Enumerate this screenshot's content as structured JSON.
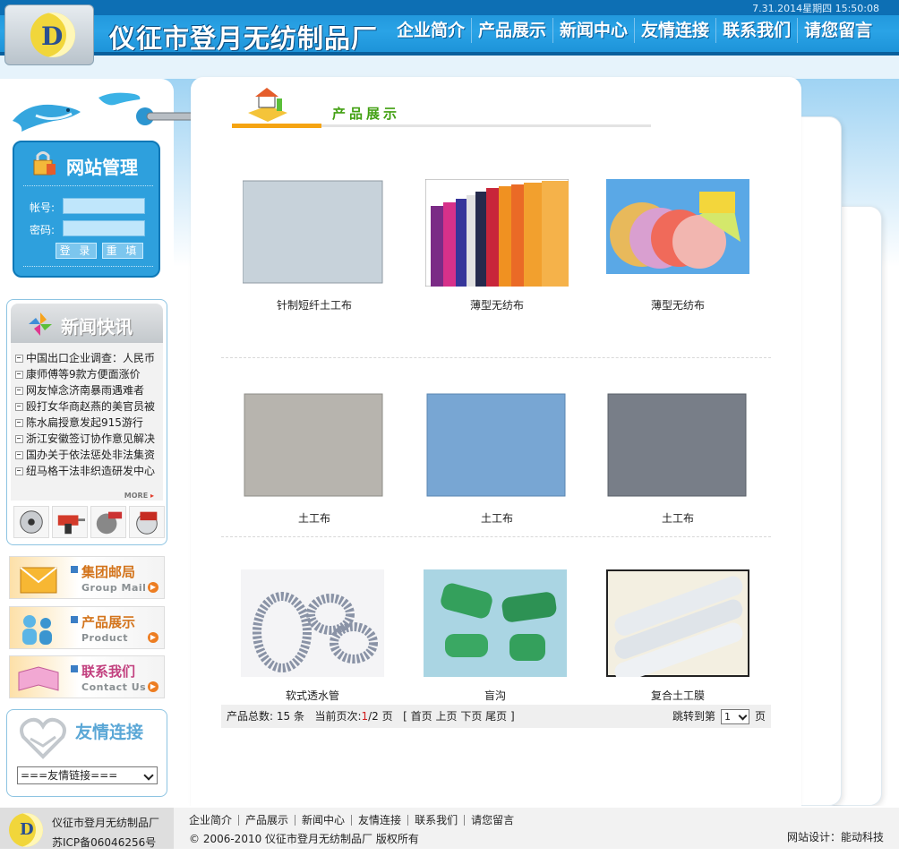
{
  "header": {
    "date": "7.31.2014",
    "weekday": "星期四",
    "time": "15:50:08",
    "logo_letter": "D",
    "site_title": "仪征市登月无纺制品厂",
    "nav": [
      "企业简介",
      "产品展示",
      "新闻中心",
      "友情连接",
      "联系我们",
      "请您留言"
    ]
  },
  "sidebar": {
    "admin": {
      "title": "网站管理",
      "account_label": "帐号:",
      "password_label": "密码:",
      "login_label": "登 录",
      "reset_label": "重 填"
    },
    "news": {
      "title": "新闻快讯",
      "items": [
        "中国出口企业调查：人民币",
        "康师傅等9款方便面涨价",
        "网友悼念济南暴雨遇难者",
        "殴打女华商赵燕的美官员被",
        "陈水扁授意发起915游行",
        "浙江安徽签订协作意见解决",
        "国办关于依法惩处非法集资",
        "纽马格干法非织造研发中心"
      ],
      "more": "MORE"
    },
    "promos": [
      {
        "title": "集团邮局",
        "subtitle": "Group Mail"
      },
      {
        "title": "产品展示",
        "subtitle": "Product"
      },
      {
        "title": "联系我们",
        "subtitle": "Contact Us"
      }
    ],
    "friend_links": {
      "title": "友情连接",
      "select_value": "===友情链接==="
    }
  },
  "main": {
    "title": "产品展示",
    "products": [
      {
        "name": "针制短纤土工布",
        "color": "#c7d2da"
      },
      {
        "name": "薄型无纺布",
        "color": "#d6392e"
      },
      {
        "name": "薄型无纺布",
        "color": "#5aa8e6"
      },
      {
        "name": "土工布",
        "color": "#b7b4ae"
      },
      {
        "name": "土工布",
        "color": "#78a6d3"
      },
      {
        "name": "土工布",
        "color": "#787e88"
      },
      {
        "name": "软式透水管",
        "color": "#8a93a6"
      },
      {
        "name": "盲沟",
        "color": "#34a05c"
      },
      {
        "name": "复合土工膜",
        "color": "#e7ebef"
      }
    ],
    "pager": {
      "total_label": "产品总数:",
      "total": "15",
      "unit": "条",
      "current_label": "当前页次:",
      "current": "1",
      "pages": "/2",
      "page_unit": "页",
      "first": "首页",
      "prev": "上页",
      "next": "下页",
      "last": "尾页",
      "jump_label": "跳转到第",
      "jump_value": "1",
      "jump_unit": "页"
    }
  },
  "footer": {
    "logo_letter": "D",
    "company": "仪征市登月无纺制品厂",
    "icp": "苏ICP备06046256号",
    "links": [
      "企业简介",
      "产品展示",
      "新闻中心",
      "友情连接",
      "联系我们",
      "请您留言"
    ],
    "copyright": "© 2006-2010  仪征市登月无纺制品厂  版权所有",
    "design": "网站设计：能动科技"
  }
}
